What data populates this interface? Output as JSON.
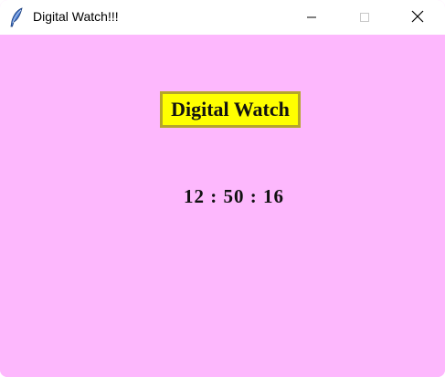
{
  "window": {
    "title": "Digital Watch!!!",
    "icon": "feather-icon",
    "controls": {
      "minimize": "minimize-icon",
      "maximize": "maximize-icon",
      "close": "close-icon"
    }
  },
  "content": {
    "heading": "Digital Watch",
    "time": "12 : 50 : 16"
  },
  "colors": {
    "background": "#fdb8fd",
    "heading_background": "#ffff00",
    "heading_border": "#b5a62a",
    "text": "#111111"
  }
}
